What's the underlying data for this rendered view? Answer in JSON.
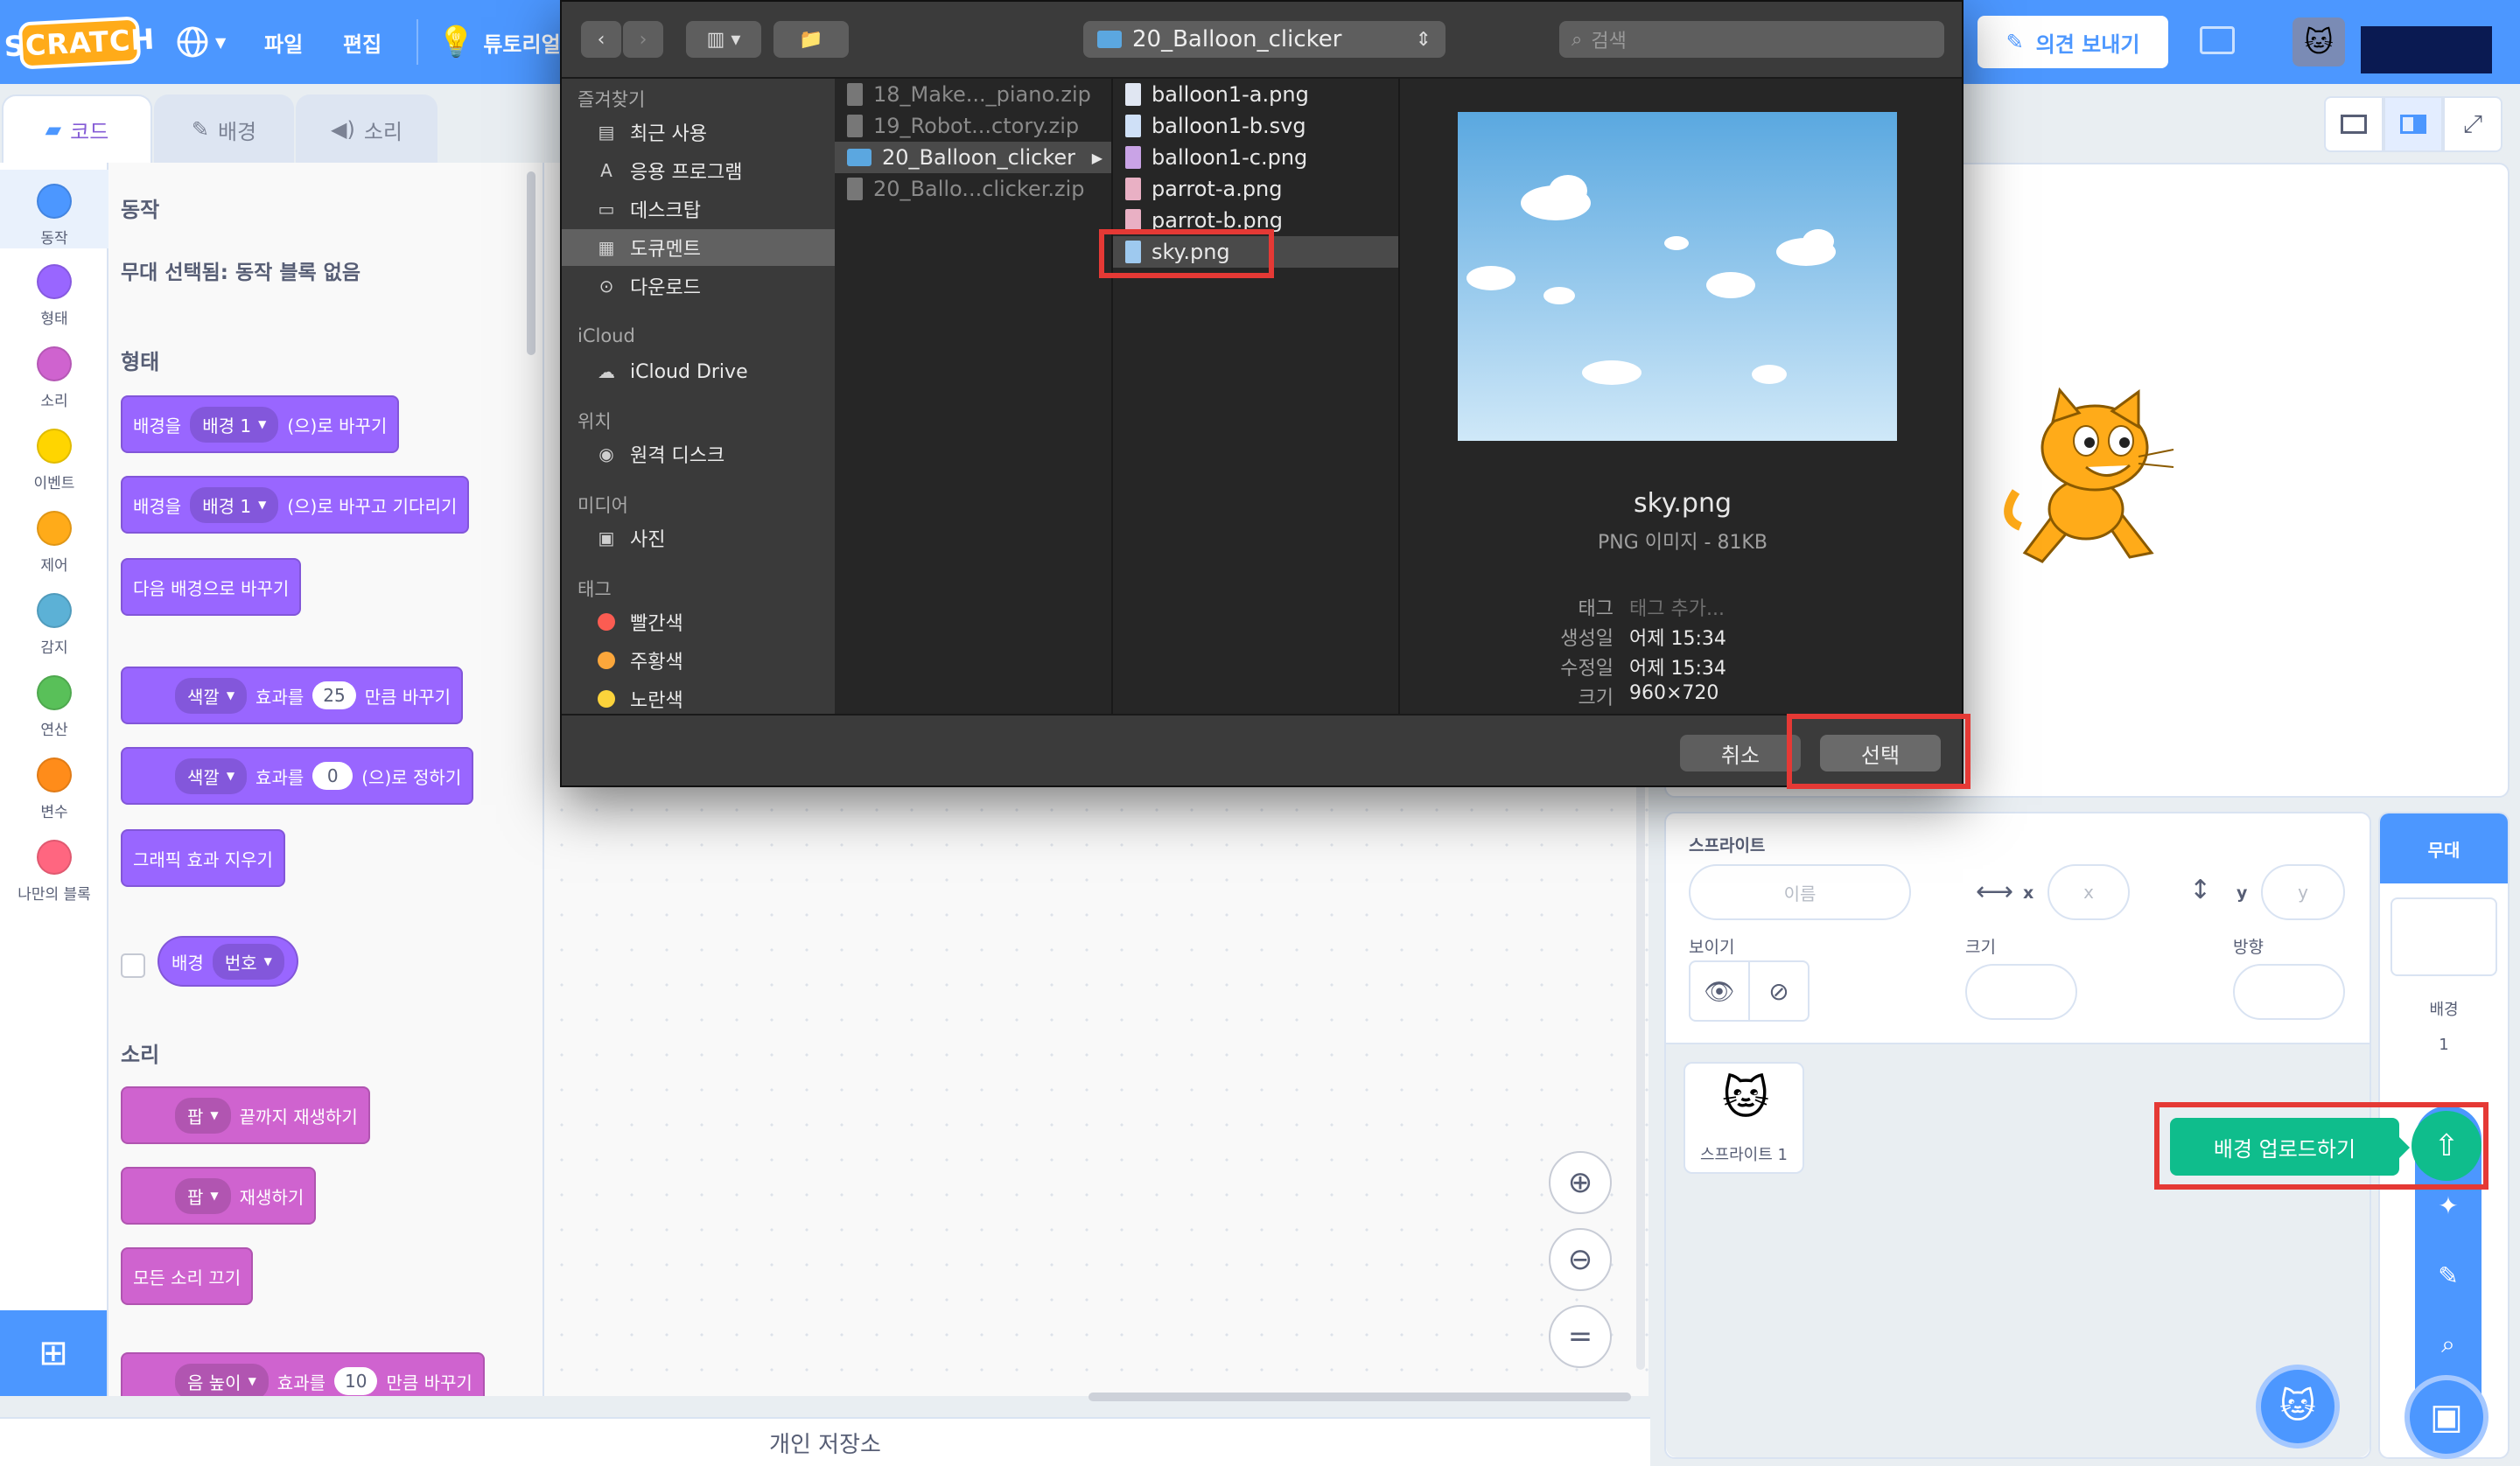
{
  "menubar": {
    "logo": "SCRATCH",
    "file": "파일",
    "edit": "편집",
    "tutorial": "튜토리얼",
    "feedback": "의견 보내기"
  },
  "tabs": {
    "code": "코드",
    "backdrop": "배경",
    "sound": "소리"
  },
  "categories": [
    {
      "label": "동작",
      "color": "#4c97ff"
    },
    {
      "label": "형태",
      "color": "#9966ff"
    },
    {
      "label": "소리",
      "color": "#cf63cf"
    },
    {
      "label": "이벤트",
      "color": "#ffd500"
    },
    {
      "label": "제어",
      "color": "#ffab19"
    },
    {
      "label": "감지",
      "color": "#5cb1d6"
    },
    {
      "label": "연산",
      "color": "#59c059"
    },
    {
      "label": "변수",
      "color": "#ff8c1a"
    },
    {
      "label": "나만의 블록",
      "color": "#ff6680"
    }
  ],
  "palette": {
    "motion_title": "동작",
    "motion_note": "무대 선택됨: 동작 블록 없음",
    "looks_title": "형태",
    "sound_title": "소리",
    "blocks": {
      "b1_pre": "배경을",
      "b1_pill": "배경 1",
      "b1_post": "(으)로 바꾸기",
      "b2_pre": "배경을",
      "b2_pill": "배경 1",
      "b2_post": "(으)로 바꾸고 기다리기",
      "b3": "다음 배경으로 바꾸기",
      "b4_pill": "색깔",
      "b4_mid": "효과를",
      "b4_num": "25",
      "b4_post": "만큼 바꾸기",
      "b5_pill": "색깔",
      "b5_mid": "효과를",
      "b5_num": "0",
      "b5_post": "(으)로 정하기",
      "b6": "그래픽 효과 지우기",
      "b7_pre": "배경",
      "b7_pill": "번호",
      "s1_pill": "팝",
      "s1_post": "끝까지 재생하기",
      "s2_pill": "팝",
      "s2_post": "재생하기",
      "s3": "모든 소리 끄기",
      "s4_pill": "음 높이",
      "s4_mid": "효과를",
      "s4_num": "10",
      "s4_post": "만큼 바꾸기"
    }
  },
  "backpack": "개인 저장소",
  "sprite_panel": {
    "sprite_label": "스프라이트",
    "name_placeholder": "이름",
    "x_label": "x",
    "x_placeholder": "x",
    "y_label": "y",
    "y_placeholder": "y",
    "show_label": "보이기",
    "size_label": "크기",
    "direction_label": "방향",
    "sprite_item": "스프라이트 1"
  },
  "stage_panel": {
    "title": "무대",
    "backdrops_label": "배경",
    "backdrops_count": "1",
    "upload_tooltip": "배경 업로드하기"
  },
  "dialog": {
    "location": "20_Balloon_clicker",
    "search_placeholder": "검색",
    "sidebar": {
      "favorites": "즐겨찾기",
      "recents": "최근 사용",
      "applications": "응용 프로그램",
      "desktop": "데스크탑",
      "documents": "도큐멘트",
      "downloads": "다운로드",
      "icloud": "iCloud",
      "icloud_drive": "iCloud Drive",
      "locations": "위치",
      "remote_disc": "원격 디스크",
      "media": "미디어",
      "photos": "사진",
      "tags": "태그",
      "tag_red": "빨간색",
      "tag_orange": "주황색",
      "tag_yellow": "노란색"
    },
    "col1": [
      "18_Make..._piano.zip",
      "19_Robot...ctory.zip",
      "20_Balloon_clicker",
      "20_Ballo...clicker.zip"
    ],
    "col2": [
      "balloon1-a.png",
      "balloon1-b.svg",
      "balloon1-c.png",
      "parrot-a.png",
      "parrot-b.png",
      "sky.png"
    ],
    "preview": {
      "filename": "sky.png",
      "kind": "PNG 이미지 - 81KB",
      "tags_label": "태그",
      "tags_value": "태그 추가...",
      "created_label": "생성일",
      "created_value": "어제 15:34",
      "modified_label": "수정일",
      "modified_value": "어제 15:34",
      "size_label": "크기",
      "size_value": "960×720"
    },
    "cancel": "취소",
    "select": "선택"
  }
}
